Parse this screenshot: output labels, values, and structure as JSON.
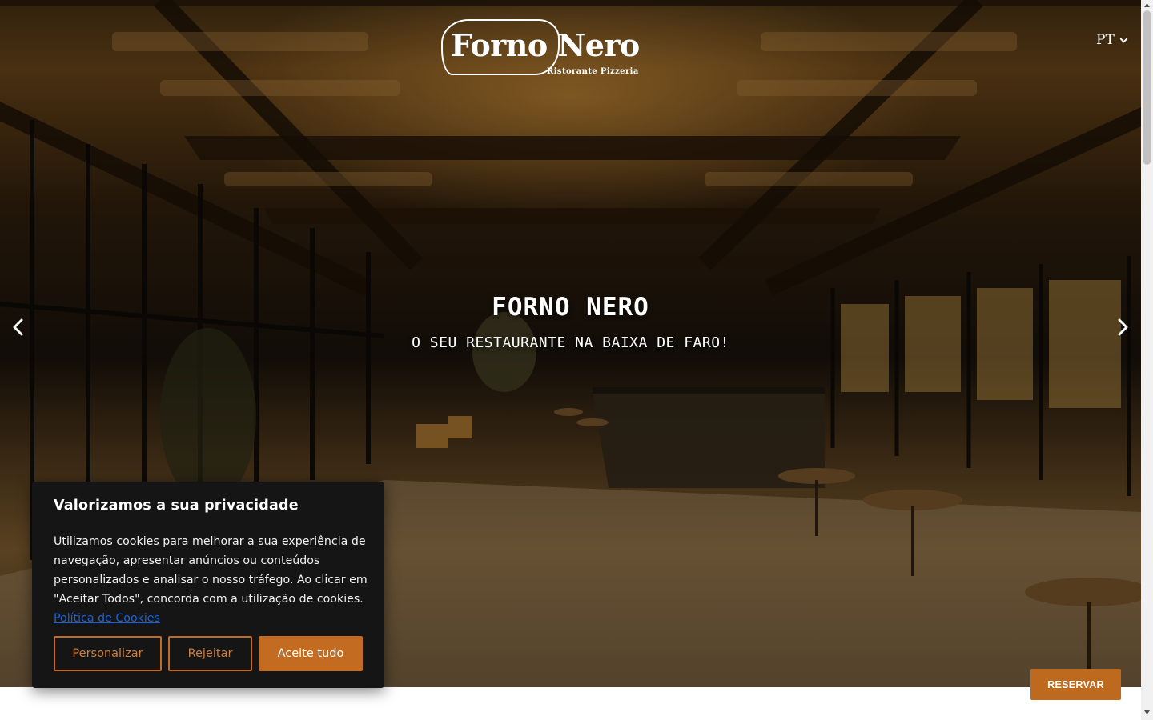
{
  "brand": {
    "logo_name": "Forno Nero",
    "logo_sub": "Ristorante Pizzeria"
  },
  "language": {
    "selected": "PT",
    "icon": "chevron-down-icon"
  },
  "hero": {
    "title": "FORNO NERO",
    "subtitle": "O SEU RESTAURANTE NA BAIXA DE FARO!",
    "prev_icon": "chevron-left-icon",
    "next_icon": "chevron-right-icon"
  },
  "cookie_banner": {
    "title": "Valorizamos a sua privacidade",
    "text": "Utilizamos cookies para melhorar a sua experiência de navegação, apresentar anúncios ou conteúdos personalizados e analisar o nosso tráfego. Ao clicar em \"Aceitar Todos\", concorda com a utilização de cookies.",
    "policy_link": "Política de Cookies",
    "buttons": {
      "customize": "Personalizar",
      "reject": "Rejeitar",
      "accept": "Aceite tudo"
    }
  },
  "reserve_button": "RESERVAR",
  "colors": {
    "accent": "#c36b21",
    "banner_bg": "#151515",
    "link": "#1863dc"
  }
}
